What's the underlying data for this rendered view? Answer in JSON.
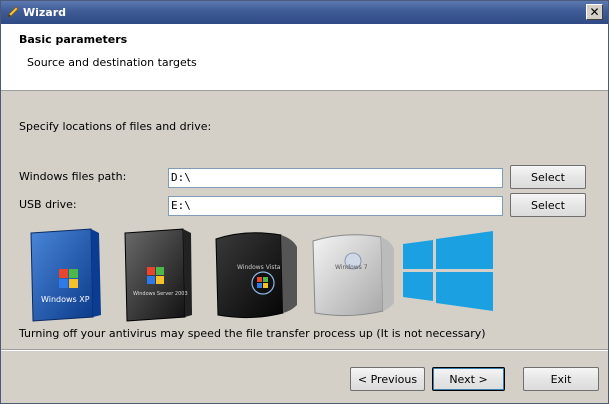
{
  "window": {
    "title": "Wizard",
    "close_glyph": "✕"
  },
  "header": {
    "title": "Basic parameters",
    "subtitle": "Source and destination targets"
  },
  "form": {
    "instruction": "Specify locations of files and drive:",
    "windows_path": {
      "label": "Windows files path:",
      "value": "D:\\",
      "button": "Select"
    },
    "usb_drive": {
      "label": "USB drive:",
      "value": "E:\\",
      "button": "Select"
    }
  },
  "logos": [
    {
      "name": "windows-xp-box-icon",
      "text": "Windows XP"
    },
    {
      "name": "windows-server-2003-box-icon",
      "text": "Windows Server 2003"
    },
    {
      "name": "windows-vista-box-icon",
      "text": "Windows Vista"
    },
    {
      "name": "windows-7-box-icon",
      "text": "Windows 7"
    },
    {
      "name": "windows-8-logo-icon",
      "text": ""
    }
  ],
  "note": "Turning off your antivirus may speed the file transfer process up (It is not necessary)",
  "footer": {
    "previous": "< Previous",
    "next": "Next >",
    "exit": "Exit"
  },
  "colors": {
    "title_bar": "#3f5b96",
    "win8_blue": "#1ba1e2",
    "dialog_bg": "#d4d0c8"
  }
}
